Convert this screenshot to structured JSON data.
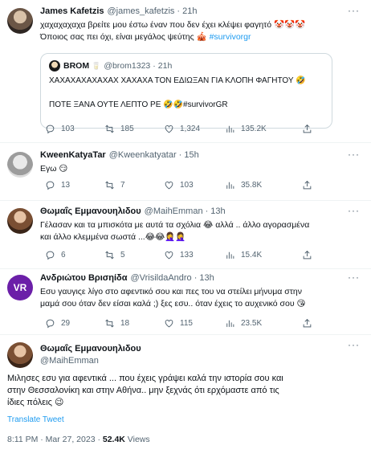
{
  "tweets": [
    {
      "name": "James Kafetzis",
      "handle": "@james_kafetzis",
      "time": "21h",
      "line1": "χαχαχαχαχα βρείτε μου έστω έναν που δεν έχει κλέψει φαγητό 🤡🤡🤡",
      "line2_text": "Όποιος σας πει όχι, είναι μεγάλος ψεύτης 🎪 ",
      "line2_tag": "#survivorgr",
      "quote": {
        "name": "BROM",
        "badge": "🥛",
        "handle": "@brom1323",
        "time": "21h",
        "line1": "ΧΑΧΑΧΑΧΑΧΑΧΑΧ ΧΑΧΑΧΑ ΤΟΝ ΕΔΙΩΞΑΝ ΓΙΑ ΚΛΟΠΗ ΦΑΓΗΤΟΥ 🤣",
        "line2": "ΠΟΤΕ ΞΑΝΑ ΟΥΤΕ ΛΕΠΤΟ ΡΕ 🤣🤣#survivorGR"
      },
      "replies": "103",
      "retweets": "185",
      "likes": "1,324",
      "views": "135.2K"
    },
    {
      "name": "KweenKatyaTar",
      "handle": "@Kweenkatyatar",
      "time": "15h",
      "line1": "Εγω 😏",
      "replies": "13",
      "retweets": "7",
      "likes": "103",
      "views": "35.8K"
    },
    {
      "name": "Θωμαΐς Εμμανουηλιδου",
      "handle": "@MaihEmman",
      "time": "13h",
      "line1": "Γέλασαν και τα μπισκότα με αυτά τα σχόλια 😂 αλλά .. άλλο αγορασμένα",
      "line2": "και άλλο κλεμμένα σωστά ...😂😂🤦‍♀️🤦‍♀️",
      "replies": "6",
      "retweets": "5",
      "likes": "133",
      "views": "15.4K"
    },
    {
      "name": "Ανδριώτου Βρισηίδα",
      "handle": "@VrisildaAndro",
      "time": "13h",
      "avatar_text": "VR",
      "line1": "Εσυ γαυγιςε λίγο στο αφεντικό σου και πες του να στείλει μήνυμα στην",
      "line2": "μαμά σου όταν δεν είσαι καλά ;) ξες εσυ.. όταν έχεις το αυχενικό σου 😘",
      "replies": "29",
      "retweets": "18",
      "likes": "115",
      "views": "23.5K"
    }
  ],
  "main": {
    "name": "Θωμαΐς Εμμανουηλιδου",
    "handle": "@MaihEmman",
    "line1": "Μιλησες εσυ για αφεντικά ... που έχεις γράψει καλά την ιστορία σου και",
    "line2": "στην Θεσσαλονίκη και στην Αθήνα.. μην ξεχνάς ότι ερχόμαστε από τις",
    "line3": "ίδιες πόλεις 😉",
    "translate": "Translate Tweet",
    "time": "8:11 PM · Mar 27, 2023 · ",
    "views_count": "52.4K",
    "views_label": " Views"
  },
  "colors": {
    "accent": "#1d9bf0",
    "muted": "#536471",
    "text": "#0f1419",
    "border": "#cfd9de"
  }
}
